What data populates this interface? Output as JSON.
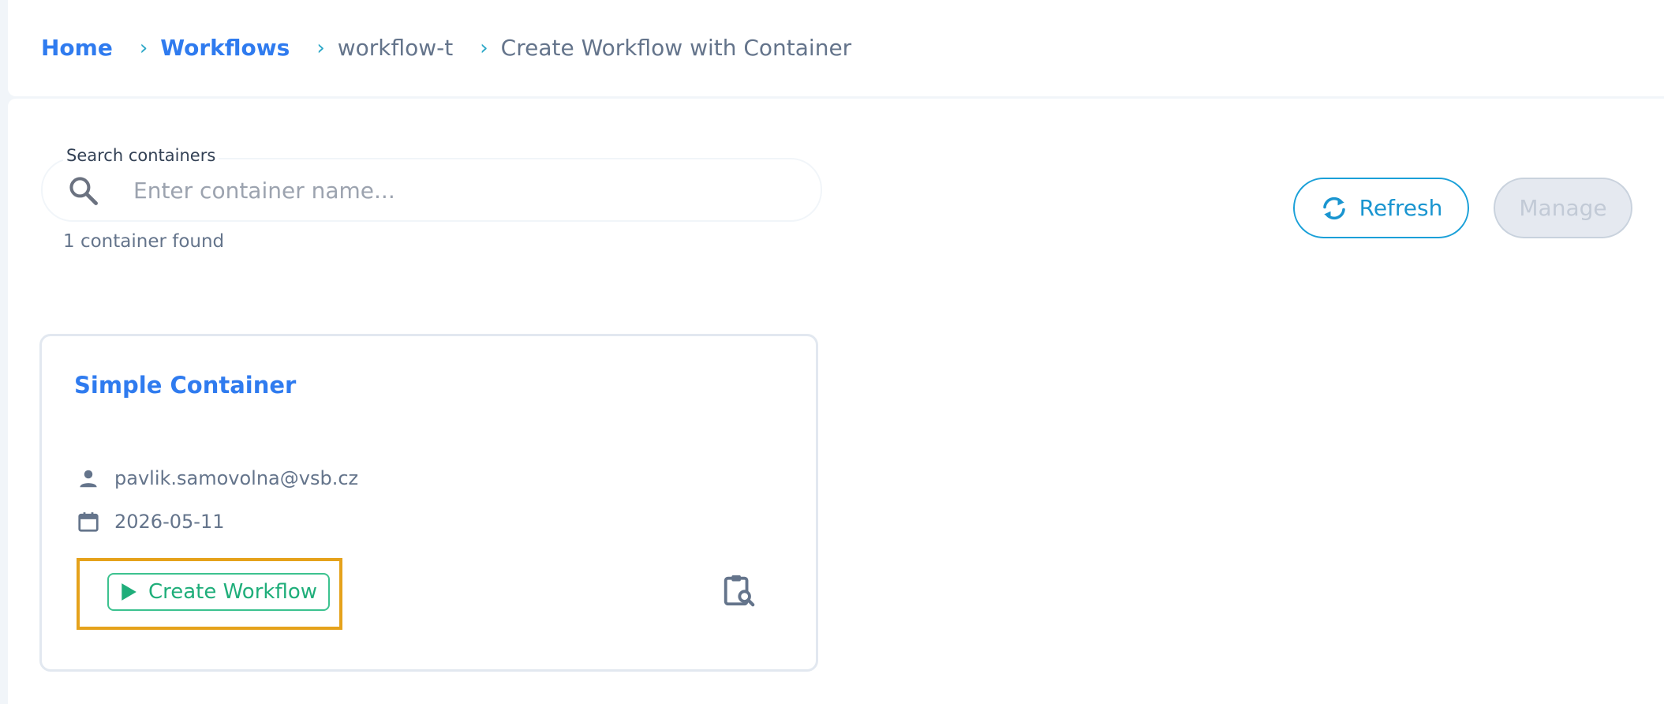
{
  "breadcrumb": {
    "home": "Home",
    "workflows": "Workflows",
    "workflow": "workflow-t",
    "current": "Create Workflow with Container",
    "separator": "›"
  },
  "search": {
    "label": "Search containers",
    "placeholder": "Enter container name...",
    "value": "",
    "result_count": "1 container found"
  },
  "toolbar": {
    "refresh_label": "Refresh",
    "manage_label": "Manage"
  },
  "card": {
    "title": "Simple Container",
    "owner": "pavlik.samovolna@vsb.cz",
    "date": "2026-05-11",
    "create_label": "Create Workflow"
  },
  "colors": {
    "link": "#2f7bef",
    "accent": "#1a95d0",
    "success": "#1fae7a",
    "highlight": "#e5a21b",
    "muted": "#64748b"
  },
  "icons": {
    "search": "search-icon",
    "refresh": "refresh-icon",
    "owner": "person-icon",
    "date": "calendar-icon",
    "create": "play-icon",
    "inspect": "clipboard-search-icon"
  }
}
